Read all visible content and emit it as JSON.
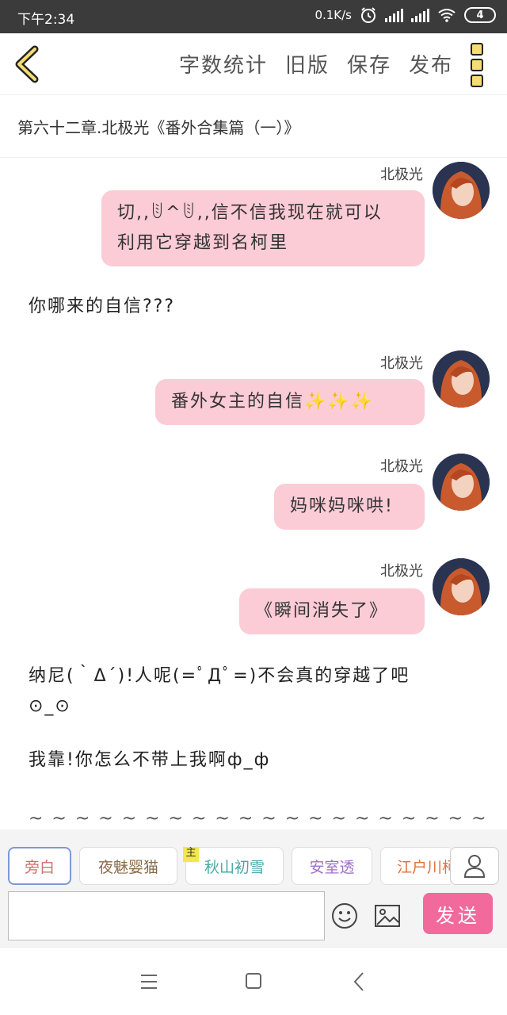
{
  "status_bar": {
    "time": "下午2:34",
    "network_speed": "0.1K/s",
    "battery": "4",
    "icons": [
      "alarm-icon",
      "signal-icon",
      "signal-icon",
      "wifi-icon",
      "battery-icon"
    ]
  },
  "toolbar": {
    "word_count_label": "字数统计",
    "old_version_label": "旧版",
    "save_label": "保存",
    "publish_label": "发布"
  },
  "chapter_title": "第六十二章.北极光《番外合集篇（一）》",
  "messages": [
    {
      "sender": "北极光",
      "text_line1": "切,,ꂹ^ꂹ,,信不信我现在就可以",
      "text_line2": "利用它穿越到名柯里"
    },
    {
      "narration": "你哪来的自信???"
    },
    {
      "sender": "北极光",
      "text": "番外女主的自信✨✨✨"
    },
    {
      "sender": "北极光",
      "text": "妈咪妈咪哄!"
    },
    {
      "sender": "北极光",
      "text": "《瞬间消失了》"
    },
    {
      "narration_line1": "纳尼(｀Δ´)!人呢(=ﾟДﾟ=)不会真的穿越了吧",
      "narration_line2": "⊙_⊙"
    },
    {
      "narration": "我靠!你怎么不带上我啊ф_ф"
    },
    {
      "narration": "~ ~ ~ ~ ~ ~ ~ ~ ~ ~ ~ ~ ~ ~ ~ ~ ~ ~ ~ ~ ~"
    }
  ],
  "characters": [
    {
      "label": "旁白",
      "color": "#d07070"
    },
    {
      "label": "夜魅婴猫",
      "color": "#8a6a4a"
    },
    {
      "label": "秋山初雪",
      "color": "#4aa8a8",
      "tag": "主"
    },
    {
      "label": "安室透",
      "color": "#a070c8"
    },
    {
      "label": "江户川柯",
      "color": "#e07040"
    }
  ],
  "composer": {
    "input_value": "",
    "send_label": "发送"
  }
}
